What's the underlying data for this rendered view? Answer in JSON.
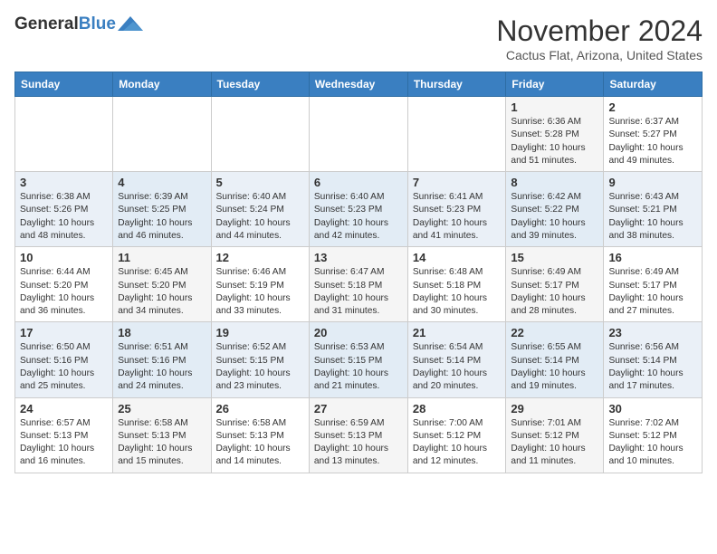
{
  "header": {
    "logo_general": "General",
    "logo_blue": "Blue",
    "month_title": "November 2024",
    "location": "Cactus Flat, Arizona, United States"
  },
  "calendar": {
    "days_of_week": [
      "Sunday",
      "Monday",
      "Tuesday",
      "Wednesday",
      "Thursday",
      "Friday",
      "Saturday"
    ],
    "weeks": [
      [
        {
          "day": "",
          "info": ""
        },
        {
          "day": "",
          "info": ""
        },
        {
          "day": "",
          "info": ""
        },
        {
          "day": "",
          "info": ""
        },
        {
          "day": "",
          "info": ""
        },
        {
          "day": "1",
          "info": "Sunrise: 6:36 AM\nSunset: 5:28 PM\nDaylight: 10 hours and 51 minutes."
        },
        {
          "day": "2",
          "info": "Sunrise: 6:37 AM\nSunset: 5:27 PM\nDaylight: 10 hours and 49 minutes."
        }
      ],
      [
        {
          "day": "3",
          "info": "Sunrise: 6:38 AM\nSunset: 5:26 PM\nDaylight: 10 hours and 48 minutes."
        },
        {
          "day": "4",
          "info": "Sunrise: 6:39 AM\nSunset: 5:25 PM\nDaylight: 10 hours and 46 minutes."
        },
        {
          "day": "5",
          "info": "Sunrise: 6:40 AM\nSunset: 5:24 PM\nDaylight: 10 hours and 44 minutes."
        },
        {
          "day": "6",
          "info": "Sunrise: 6:40 AM\nSunset: 5:23 PM\nDaylight: 10 hours and 42 minutes."
        },
        {
          "day": "7",
          "info": "Sunrise: 6:41 AM\nSunset: 5:23 PM\nDaylight: 10 hours and 41 minutes."
        },
        {
          "day": "8",
          "info": "Sunrise: 6:42 AM\nSunset: 5:22 PM\nDaylight: 10 hours and 39 minutes."
        },
        {
          "day": "9",
          "info": "Sunrise: 6:43 AM\nSunset: 5:21 PM\nDaylight: 10 hours and 38 minutes."
        }
      ],
      [
        {
          "day": "10",
          "info": "Sunrise: 6:44 AM\nSunset: 5:20 PM\nDaylight: 10 hours and 36 minutes."
        },
        {
          "day": "11",
          "info": "Sunrise: 6:45 AM\nSunset: 5:20 PM\nDaylight: 10 hours and 34 minutes."
        },
        {
          "day": "12",
          "info": "Sunrise: 6:46 AM\nSunset: 5:19 PM\nDaylight: 10 hours and 33 minutes."
        },
        {
          "day": "13",
          "info": "Sunrise: 6:47 AM\nSunset: 5:18 PM\nDaylight: 10 hours and 31 minutes."
        },
        {
          "day": "14",
          "info": "Sunrise: 6:48 AM\nSunset: 5:18 PM\nDaylight: 10 hours and 30 minutes."
        },
        {
          "day": "15",
          "info": "Sunrise: 6:49 AM\nSunset: 5:17 PM\nDaylight: 10 hours and 28 minutes."
        },
        {
          "day": "16",
          "info": "Sunrise: 6:49 AM\nSunset: 5:17 PM\nDaylight: 10 hours and 27 minutes."
        }
      ],
      [
        {
          "day": "17",
          "info": "Sunrise: 6:50 AM\nSunset: 5:16 PM\nDaylight: 10 hours and 25 minutes."
        },
        {
          "day": "18",
          "info": "Sunrise: 6:51 AM\nSunset: 5:16 PM\nDaylight: 10 hours and 24 minutes."
        },
        {
          "day": "19",
          "info": "Sunrise: 6:52 AM\nSunset: 5:15 PM\nDaylight: 10 hours and 23 minutes."
        },
        {
          "day": "20",
          "info": "Sunrise: 6:53 AM\nSunset: 5:15 PM\nDaylight: 10 hours and 21 minutes."
        },
        {
          "day": "21",
          "info": "Sunrise: 6:54 AM\nSunset: 5:14 PM\nDaylight: 10 hours and 20 minutes."
        },
        {
          "day": "22",
          "info": "Sunrise: 6:55 AM\nSunset: 5:14 PM\nDaylight: 10 hours and 19 minutes."
        },
        {
          "day": "23",
          "info": "Sunrise: 6:56 AM\nSunset: 5:14 PM\nDaylight: 10 hours and 17 minutes."
        }
      ],
      [
        {
          "day": "24",
          "info": "Sunrise: 6:57 AM\nSunset: 5:13 PM\nDaylight: 10 hours and 16 minutes."
        },
        {
          "day": "25",
          "info": "Sunrise: 6:58 AM\nSunset: 5:13 PM\nDaylight: 10 hours and 15 minutes."
        },
        {
          "day": "26",
          "info": "Sunrise: 6:58 AM\nSunset: 5:13 PM\nDaylight: 10 hours and 14 minutes."
        },
        {
          "day": "27",
          "info": "Sunrise: 6:59 AM\nSunset: 5:13 PM\nDaylight: 10 hours and 13 minutes."
        },
        {
          "day": "28",
          "info": "Sunrise: 7:00 AM\nSunset: 5:12 PM\nDaylight: 10 hours and 12 minutes."
        },
        {
          "day": "29",
          "info": "Sunrise: 7:01 AM\nSunset: 5:12 PM\nDaylight: 10 hours and 11 minutes."
        },
        {
          "day": "30",
          "info": "Sunrise: 7:02 AM\nSunset: 5:12 PM\nDaylight: 10 hours and 10 minutes."
        }
      ]
    ]
  }
}
